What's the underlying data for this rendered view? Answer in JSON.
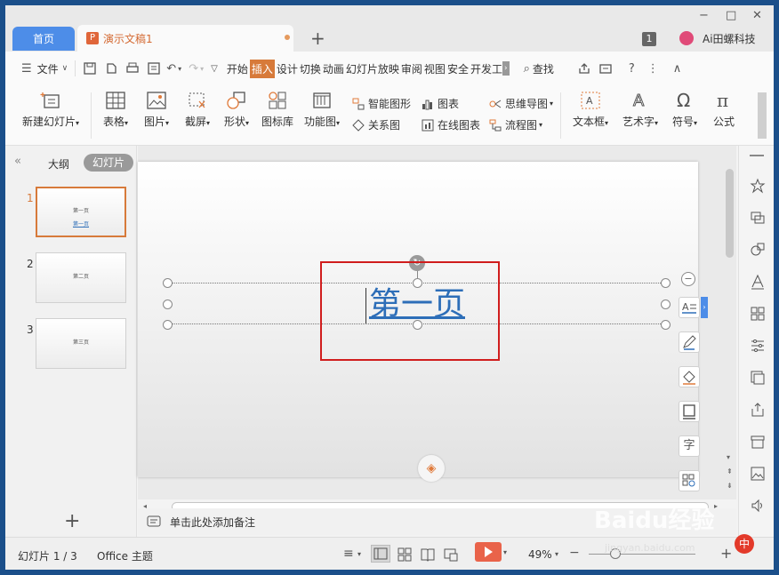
{
  "titlebar": {
    "home_tab": "首页",
    "doc_tab": "演示文稿1",
    "doc_icon": "P",
    "add_tab": "+",
    "minimize": "−",
    "maximize": "□",
    "close": "✕",
    "badge": "1",
    "user": "Ai田螺科技"
  },
  "menubar": {
    "file": "文件",
    "tabs": [
      "开始",
      "插入",
      "设计",
      "切换",
      "动画",
      "幻灯片放映",
      "审阅",
      "视图",
      "安全",
      "开发工"
    ],
    "active_tab": "插入",
    "search": "查找"
  },
  "ribbon": {
    "new_slide": "新建幻灯片",
    "table": "表格",
    "picture": "图片",
    "screenshot": "截屏",
    "shape": "形状",
    "icon_lib": "图标库",
    "func_chart": "功能图",
    "smart_graphic": "智能图形",
    "chart": "图表",
    "mind_map": "思维导图",
    "relation_map": "关系图",
    "online_chart": "在线图表",
    "flowchart": "流程图",
    "textbox": "文本框",
    "art_text": "艺术字",
    "symbol": "符号",
    "formula": "公式"
  },
  "leftpanel": {
    "outline_tab": "大纲",
    "slides_tab": "幻灯片",
    "slides": [
      {
        "num": "1",
        "title": "第一页",
        "sub": "第一页"
      },
      {
        "num": "2",
        "title": "第二页"
      },
      {
        "num": "3",
        "title": "第三页"
      }
    ],
    "add": "+"
  },
  "slide": {
    "title": "第一页"
  },
  "notes": {
    "placeholder": "单击此处添加备注"
  },
  "status": {
    "slide_info": "幻灯片 1 / 3",
    "theme": "Office 主题",
    "zoom": "49%"
  },
  "watermark": {
    "brand": "Baidu经验",
    "url": "jingyan.baidu.com"
  },
  "ime": "中",
  "colors": {
    "accent": "#d77a3a",
    "home_tab": "#4d8de8",
    "title_text": "#2d6eb8",
    "highlight_frame": "#d01d1d",
    "play": "#e9634a"
  }
}
